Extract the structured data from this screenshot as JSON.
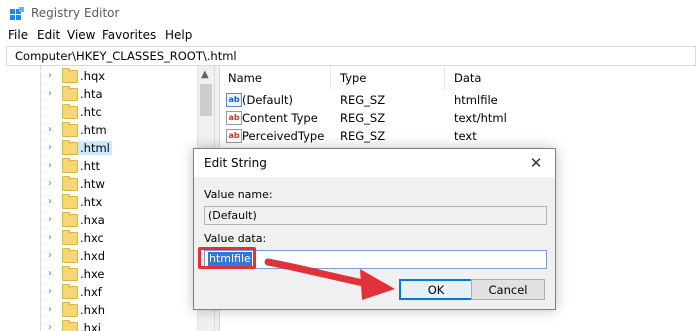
{
  "window": {
    "title": "Registry Editor"
  },
  "menu": [
    "File",
    "Edit",
    "View",
    "Favorites",
    "Help"
  ],
  "address": "Computer\\HKEY_CLASSES_ROOT\\.html",
  "tree": {
    "items": [
      ".hqx",
      ".hta",
      ".htc",
      ".htm",
      ".html",
      ".htt",
      ".htw",
      ".htx",
      ".hxa",
      ".hxc",
      ".hxd",
      ".hxe",
      ".hxf",
      ".hxh",
      ".hxi"
    ],
    "selected": ".html"
  },
  "values_pane": {
    "headers": {
      "name": "Name",
      "type": "Type",
      "data": "Data"
    },
    "rows": [
      {
        "name": "(Default)",
        "type": "REG_SZ",
        "data": "htmlfile"
      },
      {
        "name": "Content Type",
        "type": "REG_SZ",
        "data": "text/html"
      },
      {
        "name": "PerceivedType",
        "type": "REG_SZ",
        "data": "text"
      }
    ]
  },
  "dialog": {
    "title": "Edit String",
    "close_glyph": "✕",
    "value_name_label": "Value name:",
    "value_name": "(Default)",
    "value_data_label": "Value data:",
    "value_data": "htmlfile",
    "ok_label": "OK",
    "cancel_label": "Cancel"
  },
  "colors": {
    "accent": "#0078d7",
    "annotation": "#e0323a",
    "selection": "#3078d8"
  }
}
